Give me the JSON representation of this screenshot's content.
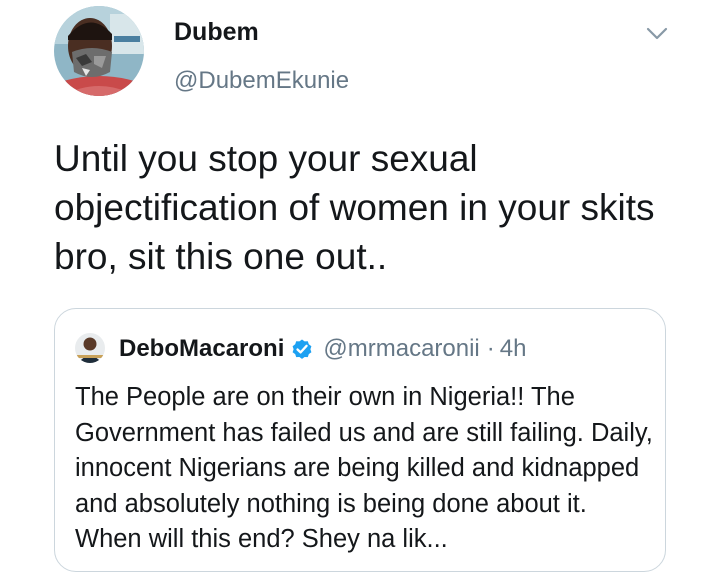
{
  "tweet": {
    "author": {
      "display_name": "Dubem",
      "handle": "@DubemEkunie"
    },
    "text": "Until you stop your sexual objectification of women in your skits bro, sit this one out..",
    "menu_icon": "chevron-down-icon"
  },
  "quoted_tweet": {
    "author": {
      "display_name": "DeboMacaroni",
      "handle": "@mrmacaronii",
      "verified": true
    },
    "separator": "·",
    "time": "4h",
    "text": "The People are on their own in Nigeria!! The Government has failed us and are still failing. Daily, innocent Nigerians are being killed and kidnapped and absolutely nothing is being done about it. When will this end? Shey na lik..."
  },
  "colors": {
    "text_primary": "#14171a",
    "text_secondary": "#657786",
    "border": "#ccd6dd",
    "verified_badge": "#1da1f2"
  }
}
